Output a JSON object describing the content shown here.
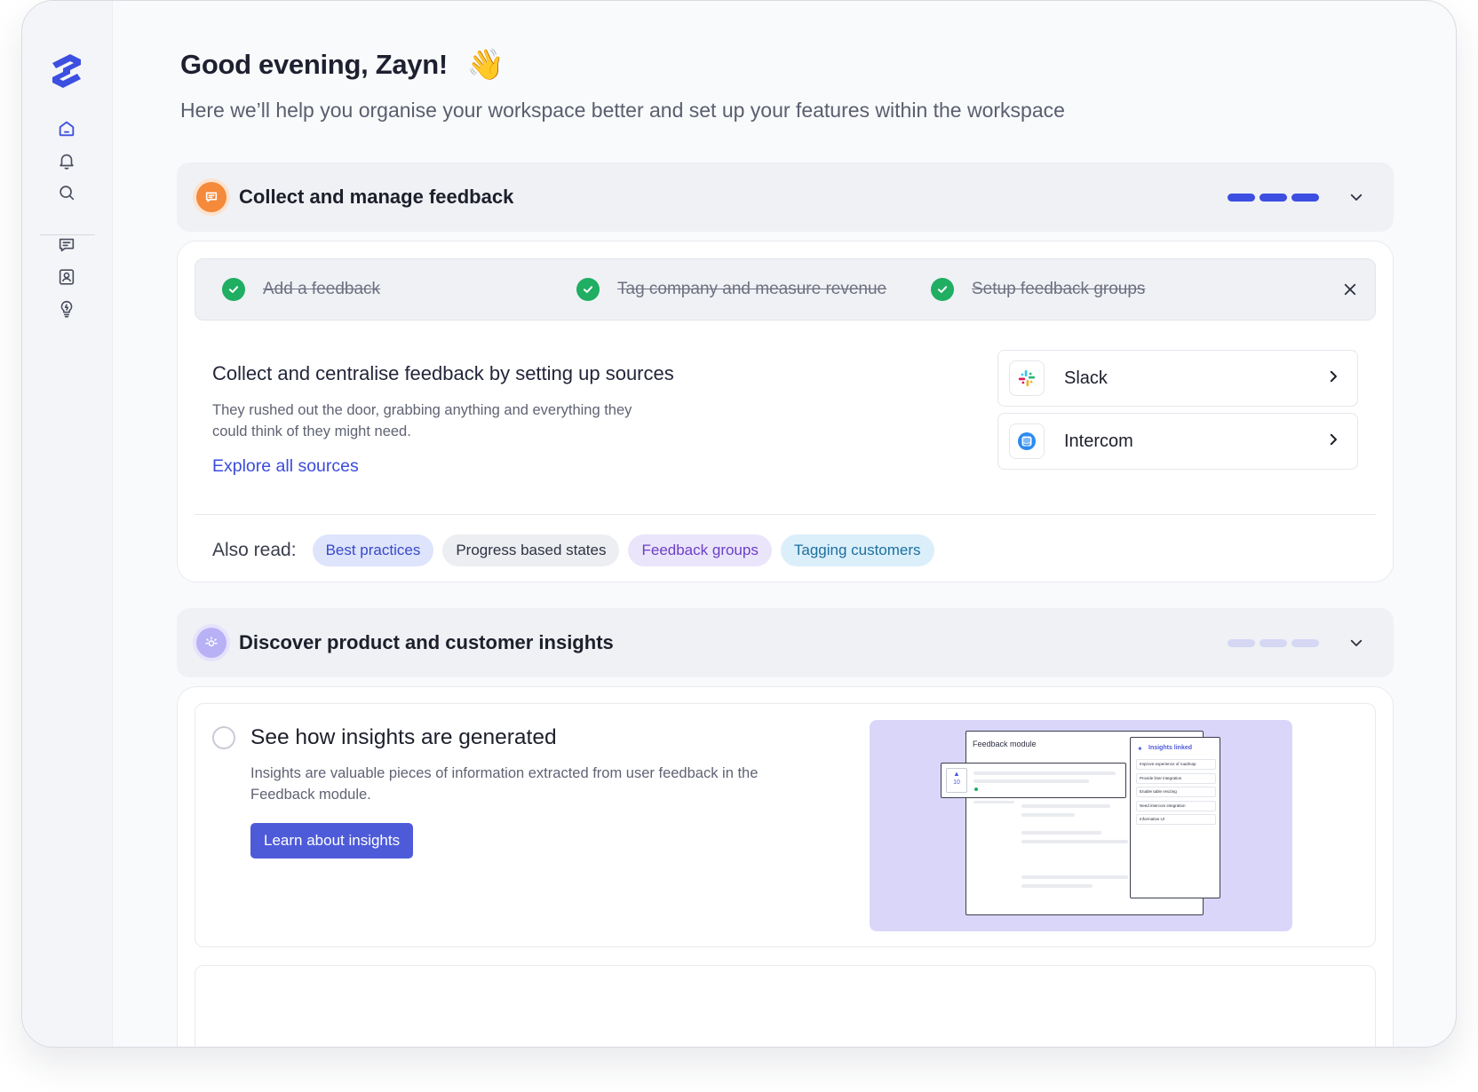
{
  "greeting": {
    "title": "Good evening, Zayn!",
    "emoji": "👋",
    "subtitle": "Here we’ll help you organise your workspace better and set up your features within the workspace"
  },
  "sidebar": {
    "items": [
      {
        "icon": "home-icon"
      },
      {
        "icon": "bell-icon"
      },
      {
        "icon": "search-icon"
      },
      {
        "icon": "feedback-icon"
      },
      {
        "icon": "contacts-icon"
      },
      {
        "icon": "insights-bulb-icon"
      }
    ]
  },
  "feedback_section": {
    "title": "Collect and manage feedback",
    "progress_completed": 3,
    "progress_total": 3,
    "steps": [
      {
        "label": "Add a feedback",
        "done": true
      },
      {
        "label": "Tag company and measure revenue",
        "done": true
      },
      {
        "label": "Setup feedback groups",
        "done": true
      }
    ],
    "sources_title": "Collect and centralise feedback by setting up sources",
    "sources_desc": "They rushed out the door, grabbing anything and everything they could think of they might need.",
    "sources_link": "Explore all sources",
    "sources": [
      {
        "name": "Slack",
        "icon": "slack-icon"
      },
      {
        "name": "Intercom",
        "icon": "intercom-icon"
      }
    ],
    "also_read_label": "Also read:",
    "chips": [
      "Best practices",
      "Progress based states",
      "Feedback groups",
      "Tagging customers"
    ]
  },
  "insights_section": {
    "title": "Discover product and customer insights",
    "progress_completed": 0,
    "progress_total": 3,
    "item_title": "See how insights are generated",
    "item_desc": "Insights are valuable pieces of information extracted from user feedback in the Feedback module.",
    "item_button": "Learn about insights",
    "illustration": {
      "module_title": "Feedback module",
      "panel_title": "Insights linked",
      "vote_count": "10",
      "panel_rows": [
        "Improve experience of roadmap",
        "Provide liner integration",
        "Enable table resizing",
        "Need intercom integration",
        "Informative UI"
      ]
    }
  },
  "colors": {
    "accent": "#3b4cdb",
    "progress_done": "#3c4fe0",
    "progress_todo": "#d5d8f2",
    "success": "#1fae62",
    "feedback_icon_bg": "#f48a3a",
    "insights_icon_bg": "#b9b1f5",
    "button": "#4e5bd9"
  }
}
